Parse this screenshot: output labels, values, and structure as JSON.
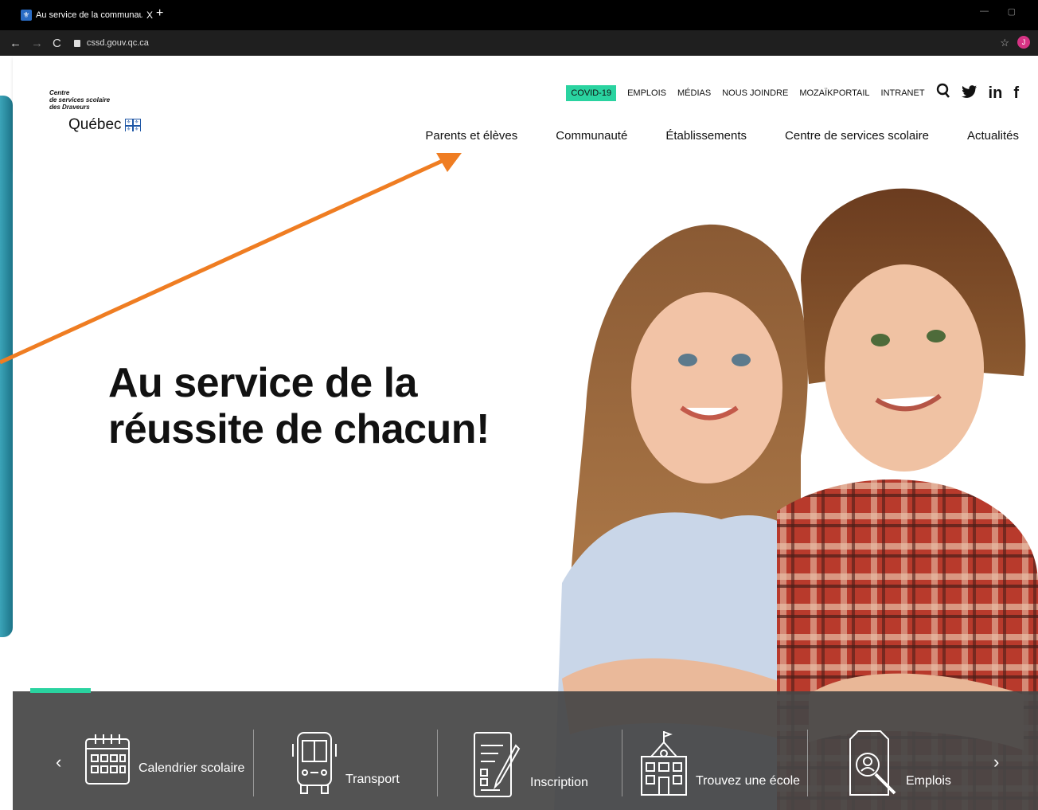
{
  "browser": {
    "tab_title": "Au service de la communauté | C",
    "tab_close": "X",
    "new_tab": "+",
    "url": "cssd.gouv.qc.ca",
    "profile_initial": "J"
  },
  "logo": {
    "line1": "Centre",
    "line2": "de services scolaire",
    "line3": "des Draveurs",
    "province": "Québec"
  },
  "utility_nav": [
    "COVID-19",
    "EMPLOIS",
    "MÉDIAS",
    "NOUS JOINDRE",
    "MOZAÏKPORTAIL",
    "INTRANET"
  ],
  "main_nav": [
    "Parents et élèves",
    "Communauté",
    "Établissements",
    "Centre de services scolaire",
    "Actualités"
  ],
  "hero": {
    "title_line1": "Au service de la",
    "title_line2": "réussite de chacun!"
  },
  "quick_links": [
    {
      "label": "Calendrier scolaire",
      "icon": "calendar-icon"
    },
    {
      "label": "Transport",
      "icon": "bus-icon"
    },
    {
      "label": "Inscription",
      "icon": "form-icon"
    },
    {
      "label": "Trouvez une école",
      "icon": "school-icon"
    },
    {
      "label": "Emplois",
      "icon": "job-search-icon"
    }
  ],
  "colors": {
    "accent": "#2ad3a0",
    "annotation_arrow": "#ef7d22",
    "bar_bg": "#464646"
  }
}
